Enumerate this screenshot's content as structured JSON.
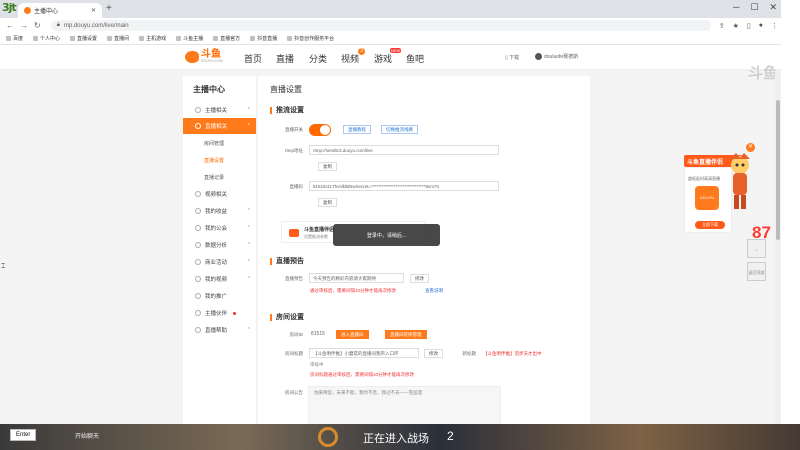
{
  "overlay": {
    "logo_text": "3jt"
  },
  "browser": {
    "tab_title": "主播中心",
    "url": "mp.douyu.com/live/main",
    "bookmarks": [
      "百度",
      "个人中心",
      "直播设置",
      "直播间",
      "主机游戏",
      "斗鱼主播",
      "直播官方",
      "抖音直播",
      "抖音创作服务平台"
    ]
  },
  "site": {
    "logo_text": "斗鱼",
    "logo_sub": "DOUYU.COM",
    "nav": [
      "首页",
      "直播",
      "分类",
      "视频",
      "游戏",
      "鱼吧"
    ],
    "video_badge": "3",
    "game_badge": "NEW",
    "download": "下载",
    "username": "douluofe赛德斯"
  },
  "sidebar": {
    "title": "主播中心",
    "items": [
      {
        "label": "主播相关"
      },
      {
        "label": "直播相关"
      },
      {
        "label": "视频相关"
      },
      {
        "label": "我的收益"
      },
      {
        "label": "我的公会"
      },
      {
        "label": "数据分析"
      },
      {
        "label": "商业活动"
      },
      {
        "label": "我的视频"
      },
      {
        "label": "我的推广"
      },
      {
        "label": "主播伙伴"
      },
      {
        "label": "直播帮助"
      }
    ],
    "subitems": [
      "房间管理",
      "直播设置",
      "直播记录"
    ]
  },
  "main": {
    "title": "直播设置",
    "push": {
      "section": "推流设置",
      "switch_label": "直播开关",
      "tutorial_btn": "直播教程",
      "stream_btn": "切换推流线路",
      "rtmp_label": "rtmp地址",
      "rtmp_value": "rtmp://sendtc3.douyu.com/live",
      "copy1": "复制",
      "code_label": "直播码",
      "code_value": "81515r41ThvslklBNwSecret=*******************************8xm7tr",
      "copy2": "复制"
    },
    "helper": {
      "title": "斗鱼直播伴侣",
      "sub": "设置推流参数"
    },
    "toast": "登录中，请稍后...",
    "preview": {
      "section": "直播预告",
      "label": "直播预告",
      "value": "今天预告的精彩内容请大家期待",
      "edit": "修改",
      "review_note": "通过审核后，需要间隔10分钟才能再次修改",
      "view_link": "查看说明"
    },
    "room": {
      "section": "房间设置",
      "room_id_label": "房间ID",
      "room_id": "81515",
      "enter_btn": "进入直播间",
      "manage_btn": "直播间装修管理",
      "title_label": "房间标题",
      "title_value": "【斗鱼明伴推】小蘑菇的直播间我带入口环",
      "title_edit": "修改",
      "new_title_label": "新标题",
      "new_title_value": "【斗鱼明伴推】羽步天才出中",
      "new_title_extra": "审核中",
      "title_note": "房间标题通过审核后，需要间隔10分钟才能再次修改",
      "notice_label": "房间公告",
      "notice_value": "怕来稀饭，未来不能，我时不急，我过不去——雪国漫"
    }
  },
  "ad": {
    "title": "斗鱼直播伴侣",
    "sub": "超低延时高清直播",
    "icon_text": "DOUYU",
    "btn": "立即下载"
  },
  "float": {
    "number": "87",
    "home_label": "返回顶部",
    "feedback_label": "反馈"
  },
  "watermark": "斗鱼",
  "bottom": {
    "enter_key": "Enter",
    "hint": "开始聊天",
    "status": "正在进入战场",
    "count": "2"
  },
  "colors": {
    "accent": "#ff7a1a",
    "link": "#2a75d6",
    "warning": "#e33333"
  }
}
